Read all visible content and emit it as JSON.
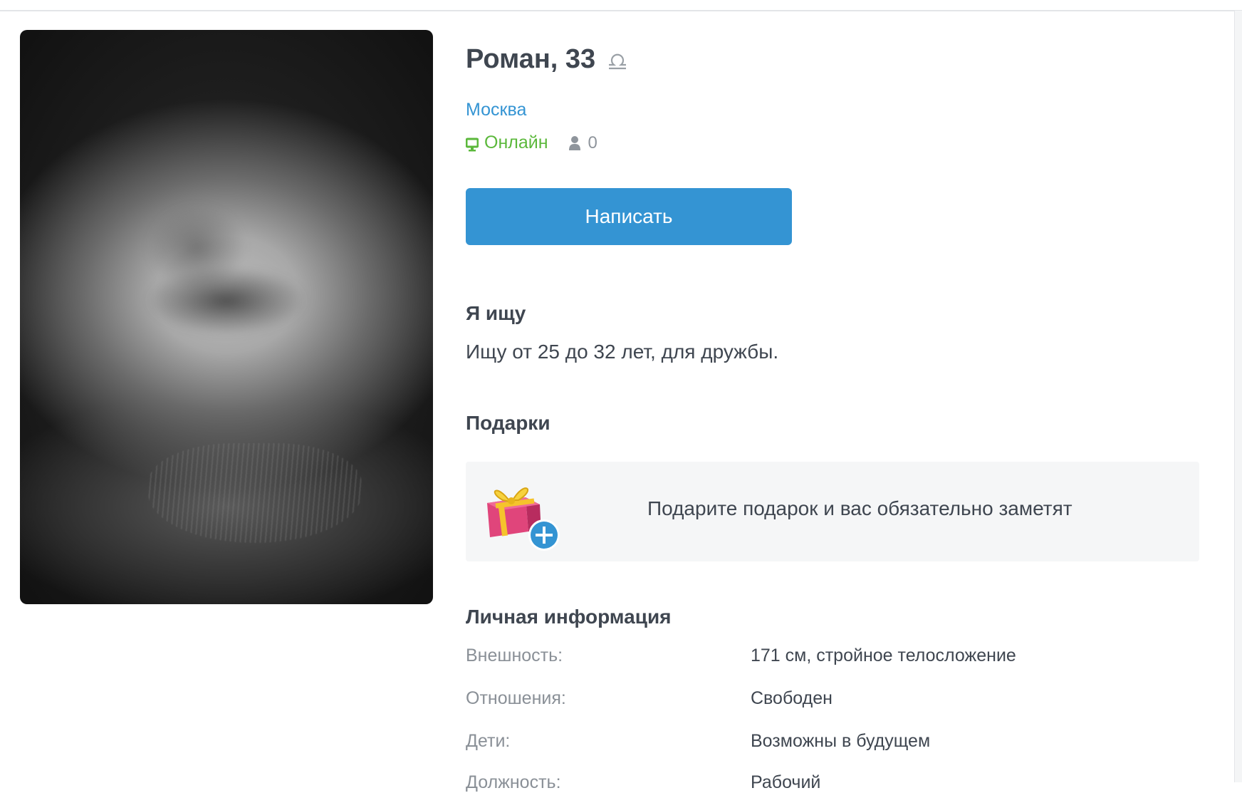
{
  "profile": {
    "name_age": "Роман, 33",
    "zodiac_icon": "libra-icon",
    "city": "Москва",
    "status": "Онлайн",
    "visitors_count": "0"
  },
  "actions": {
    "write_label": "Написать"
  },
  "looking": {
    "title": "Я ищу",
    "text": "Ищу от 25 до 32 лет, для дружбы."
  },
  "gifts": {
    "title": "Подарки",
    "prompt": "Подарите подарок и вас обязательно заметят"
  },
  "personal": {
    "title": "Личная информация",
    "rows": [
      {
        "label": "Внешность:",
        "value": "171 см, стройное телосложение"
      },
      {
        "label": "Отношения:",
        "value": "Свободен"
      },
      {
        "label": "Дети:",
        "value": "Возможны в будущем"
      },
      {
        "label": "Должность:",
        "value": "Рабочий"
      }
    ]
  },
  "colors": {
    "accent": "#3494d3",
    "online": "#5bb83b",
    "text": "#3f4650",
    "muted": "#8a9097"
  }
}
